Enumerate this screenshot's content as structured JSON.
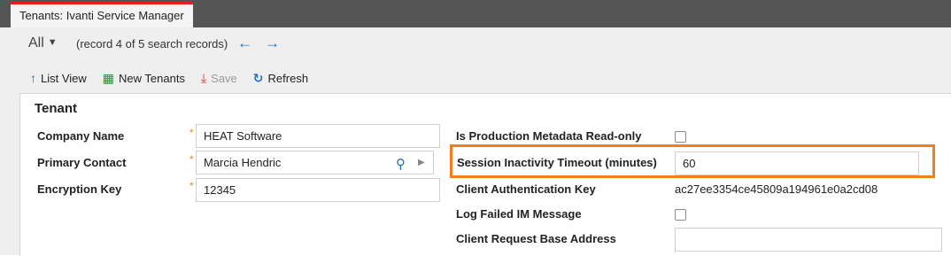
{
  "tab": {
    "label": "Tenants: Ivanti Service Manager"
  },
  "header": {
    "filter_label": "All",
    "record_info": "(record 4 of 5 search records)"
  },
  "toolbar": {
    "list_view": "List View",
    "new_tenants": "New Tenants",
    "save": "Save",
    "refresh": "Refresh"
  },
  "form": {
    "section_title": "Tenant",
    "company_name": {
      "label": "Company Name",
      "value": "HEAT Software"
    },
    "primary_contact": {
      "label": "Primary Contact",
      "value": "Marcia Hendric"
    },
    "encryption_key": {
      "label": "Encryption Key",
      "value": "12345"
    },
    "prod_metadata_readonly": {
      "label": "Is Production Metadata Read-only",
      "checked": false
    },
    "session_timeout": {
      "label": "Session Inactivity Timeout (minutes)",
      "value": "60"
    },
    "client_auth_key": {
      "label": "Client Authentication Key",
      "value": "ac27ee3354ce45809a194961e0a2cd08"
    },
    "log_failed_im": {
      "label": "Log Failed IM Message",
      "checked": false
    },
    "client_request_base": {
      "label": "Client Request Base Address",
      "value": ""
    }
  },
  "colors": {
    "accent": "#1f6fb8",
    "highlight": "#f07f1f",
    "tab_marker": "#e41f1f",
    "required": "#f08a24"
  }
}
